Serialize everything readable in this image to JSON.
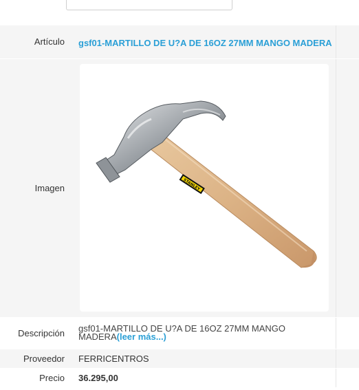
{
  "product": {
    "article_label": "Artículo",
    "article_title": "gsf01-MARTILLO DE U?A DE 16OZ 27MM MANGO MADERA",
    "image_label": "Imagen",
    "image_icon": "hammer-product-image",
    "description_label": "Descripción",
    "description_text": "gsf01-MARTILLO DE U?A DE 16OZ 27MM MANGO MADERA",
    "read_more": "(leer más...)",
    "supplier_label": "Proveedor",
    "supplier_value": "FERRICENTROS",
    "price_label": "Precio",
    "price_value": "36.295,00",
    "brand_on_handle": "STANLEY"
  },
  "colors": {
    "link": "#2a9fd6",
    "row_shade": "#f5f5f5"
  }
}
